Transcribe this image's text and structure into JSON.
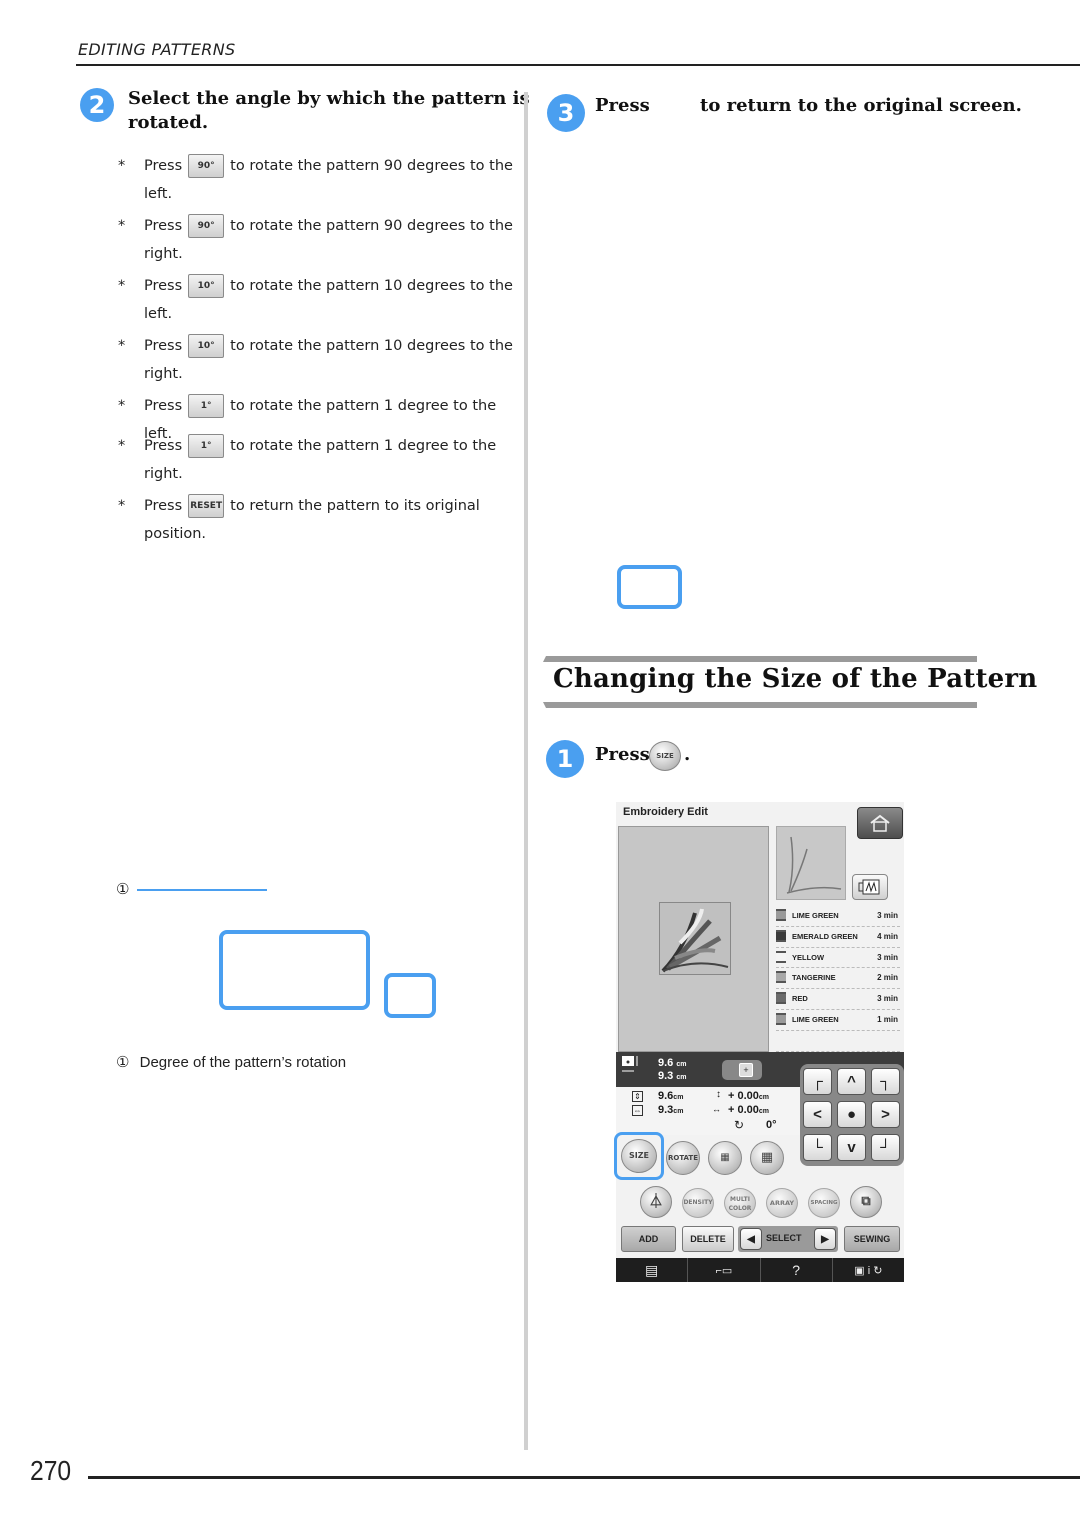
{
  "running_head": "EDITING PATTERNS",
  "left_column": {
    "step": {
      "number": "2",
      "title_line1": "Select the angle by which the pattern is",
      "title_line2": "rotated."
    },
    "bullets": [
      {
        "star": "*",
        "press": "Press",
        "button": "90° left",
        "icon": "rotate-left-90-icon",
        "text": "to rotate the pattern 90 degrees to the",
        "cont": "left."
      },
      {
        "star": "*",
        "press": "Press",
        "button": "90° right",
        "icon": "rotate-right-90-icon",
        "text": "to rotate the pattern 90 degrees to the",
        "cont": "right."
      },
      {
        "star": "*",
        "press": "Press",
        "button": "10° left",
        "icon": "rotate-left-10-icon",
        "text": "to rotate the pattern 10 degrees to the",
        "cont": "left."
      },
      {
        "star": "*",
        "press": "Press",
        "button": "10° right",
        "icon": "rotate-right-10-icon",
        "text": "to rotate the pattern 10 degrees to the",
        "cont": "right."
      },
      {
        "star": "*",
        "press": "Press",
        "button": "1° left",
        "icon": "rotate-left-1-icon",
        "text": "to rotate the pattern 1 degree to the left.",
        "cont": ""
      },
      {
        "star": "*",
        "press": "Press",
        "button": "1° right",
        "icon": "rotate-right-1-icon",
        "text": "to rotate the pattern 1 degree to the",
        "cont": "right."
      },
      {
        "star": "*",
        "press": "Press",
        "button": "RESET",
        "icon": "reset-icon",
        "text": "to return the pattern to its original",
        "cont": "position."
      }
    ],
    "button_labels": [
      "90°",
      "90°",
      "10°",
      "10°",
      "1°",
      "1°",
      "RESET"
    ],
    "callout_marker": "①",
    "caption_marker": "①",
    "caption_text": "Degree of the pattern’s rotation"
  },
  "right_column": {
    "step3": {
      "number": "3",
      "press": "Press",
      "text": "to return to the original screen."
    },
    "section_title": "Changing the Size of the Pattern",
    "step1": {
      "number": "1",
      "press": "Press",
      "button": "SIZE",
      "period": "."
    }
  },
  "lcd": {
    "title": "Embroidery Edit",
    "threads": [
      {
        "name": "LIME GREEN",
        "time": "3 min",
        "color": "#9a9a9a"
      },
      {
        "name": "EMERALD GREEN",
        "time": "4 min",
        "color": "#3a3a3a"
      },
      {
        "name": "YELLOW",
        "time": "3 min",
        "color": "#f4f4f4"
      },
      {
        "name": "TANGERINE",
        "time": "2 min",
        "color": "#a8a8a8"
      },
      {
        "name": "RED",
        "time": "3 min",
        "color": "#6a6a6a"
      },
      {
        "name": "LIME GREEN",
        "time": "1 min",
        "color": "#9a9a9a"
      }
    ],
    "dark_height": "9.6",
    "dark_width": "9.3",
    "unit": "cm",
    "info_height": "9.6",
    "info_width": "9.3",
    "offset_v": "+ 0.00",
    "offset_h": "+ 0.00",
    "rotation": "0°",
    "buttons_row1": [
      "SIZE",
      "ROTATE"
    ],
    "buttons_row2": [
      "DENSITY",
      "MULTI COLOR",
      "ARRAY",
      "SPACING"
    ],
    "add": "ADD",
    "delete": "DELETE",
    "select": "SELECT",
    "sewing": "SEWING",
    "help": "?"
  },
  "page_number": "270"
}
